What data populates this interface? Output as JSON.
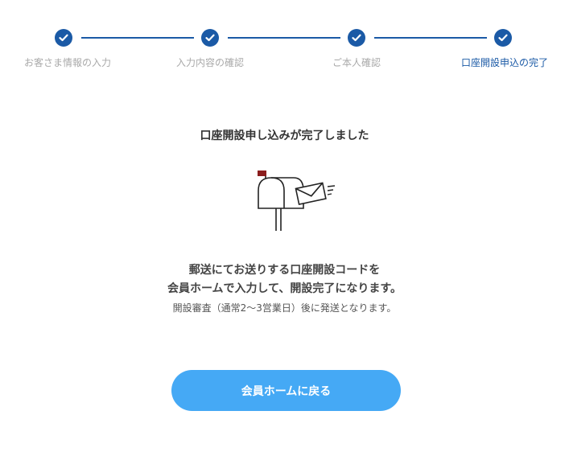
{
  "stepper": {
    "steps": [
      {
        "label": "お客さま情報の入力",
        "state": "done"
      },
      {
        "label": "入力内容の確認",
        "state": "done"
      },
      {
        "label": "ご本人確認",
        "state": "done"
      },
      {
        "label": "口座開設申込の完了",
        "state": "current"
      }
    ],
    "icon": "check-icon",
    "active_color": "#1b5aa6",
    "inactive_label_color": "#a9a9a9"
  },
  "main": {
    "title": "口座開設申し込みが完了しました",
    "illustration_icon": "mailbox-with-letter-icon",
    "message_line1": "郵送にてお送りする口座開設コードを",
    "message_line2": "会員ホームで入力して、開設完了になります。",
    "note": "開設審査（通常2〜3営業日）後に発送となります。"
  },
  "actions": {
    "home_button_label": "会員ホームに戻る",
    "button_color": "#45a9f5"
  }
}
